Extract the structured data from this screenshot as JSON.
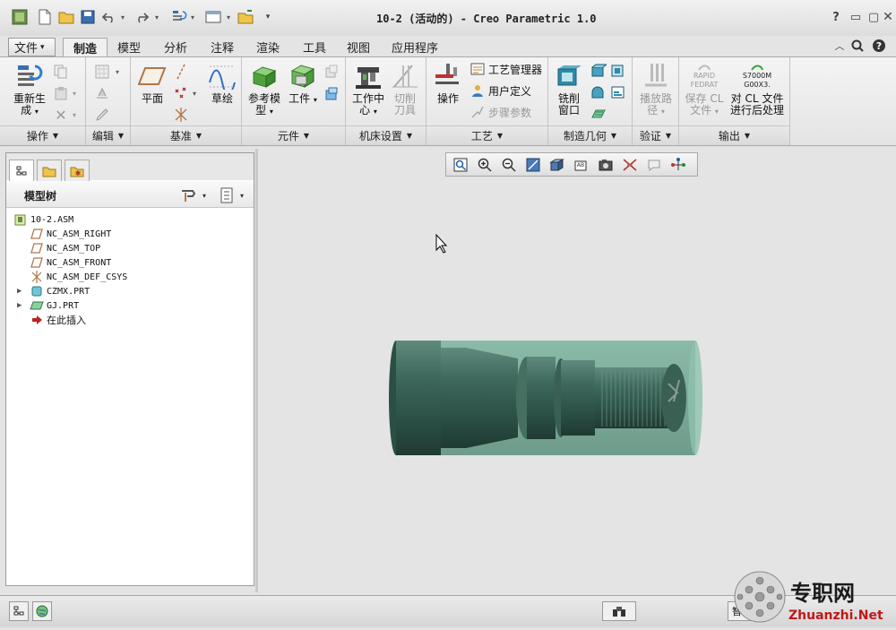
{
  "window": {
    "title": "10-2 (活动的) - Creo Parametric 1.0"
  },
  "quick_access": [
    "model-icon",
    "new-icon",
    "open-icon",
    "save-icon",
    "undo-icon",
    "redo-icon",
    "regenerate-icon",
    "windows-icon",
    "close-window-icon",
    "customize-icon"
  ],
  "tabs": [
    {
      "label": "文件",
      "arrow": "▾"
    },
    {
      "label": "制造"
    },
    {
      "label": "模型"
    },
    {
      "label": "分析"
    },
    {
      "label": "注释"
    },
    {
      "label": "渲染"
    },
    {
      "label": "工具"
    },
    {
      "label": "视图"
    },
    {
      "label": "应用程序"
    }
  ],
  "ribbon": {
    "groups": [
      {
        "label": "操作"
      },
      {
        "label": "编辑"
      },
      {
        "label": "基准"
      },
      {
        "label": "元件"
      },
      {
        "label": "机床设置"
      },
      {
        "label": "工艺"
      },
      {
        "label": "制造几何"
      },
      {
        "label": "验证"
      },
      {
        "label": "输出"
      }
    ],
    "regenerate": {
      "line1": "重新生",
      "line2": "成",
      "arrow": "▾"
    },
    "plane": "平面",
    "sketch": "草绘",
    "reference_model": {
      "line1": "参考模",
      "line2": "型",
      "arrow": "▾"
    },
    "workpiece": {
      "line1": "工件",
      "arrow": "▾"
    },
    "work_center": {
      "line1": "工作中",
      "line2": "心",
      "arrow": "▾"
    },
    "cutting_tool": {
      "line1": "切削",
      "line2": "刀具"
    },
    "operation": "操作",
    "process_manager": "工艺管理器",
    "user_defined": "用户定义",
    "step_params": "步骤参数",
    "mill_window": {
      "line1": "铣削",
      "line2": "窗口"
    },
    "play_path": {
      "line1": "播放路",
      "line2": "径",
      "arrow": "▾"
    },
    "save_cl": {
      "line1": "保存 CL",
      "line2": "文件",
      "arrow": "▾"
    },
    "rapid_icon": {
      "line1": "RAPID",
      "line2": "FEDRAT"
    },
    "post_icon": {
      "line1": "S7000M",
      "line2": "G00X3."
    },
    "post_process": {
      "line1": "对 CL 文件",
      "line2": "进行后处理"
    }
  },
  "panel": {
    "header": "模型树",
    "tree": [
      {
        "label": "10-2.ASM",
        "icon": "assembly-icon"
      },
      {
        "label": "NC_ASM_RIGHT",
        "icon": "datum-plane-icon"
      },
      {
        "label": "NC_ASM_TOP",
        "icon": "datum-plane-icon"
      },
      {
        "label": "NC_ASM_FRONT",
        "icon": "datum-plane-icon"
      },
      {
        "label": "NC_ASM_DEF_CSYS",
        "icon": "csys-icon"
      },
      {
        "label": "CZMX.PRT",
        "icon": "part-icon"
      },
      {
        "label": "GJ.PRT",
        "icon": "workpiece-icon"
      },
      {
        "label": "在此插入",
        "icon": "insert-here-icon"
      }
    ]
  },
  "view_toolbar": [
    "refit-icon",
    "zoom-in-icon",
    "zoom-out-icon",
    "repaint-icon",
    "display-style-icon",
    "saved-views-icon",
    "view-manager-icon",
    "datum-display-icon",
    "annotation-icon",
    "spin-center-icon"
  ],
  "status": {
    "right_char": "智"
  },
  "watermark": {
    "cn": "专职网",
    "url": "Zhuanzhi.Net"
  },
  "colors": {
    "part": "#3b6458",
    "workpiece": "#6fa08d",
    "accent": "#1f5fa0"
  }
}
